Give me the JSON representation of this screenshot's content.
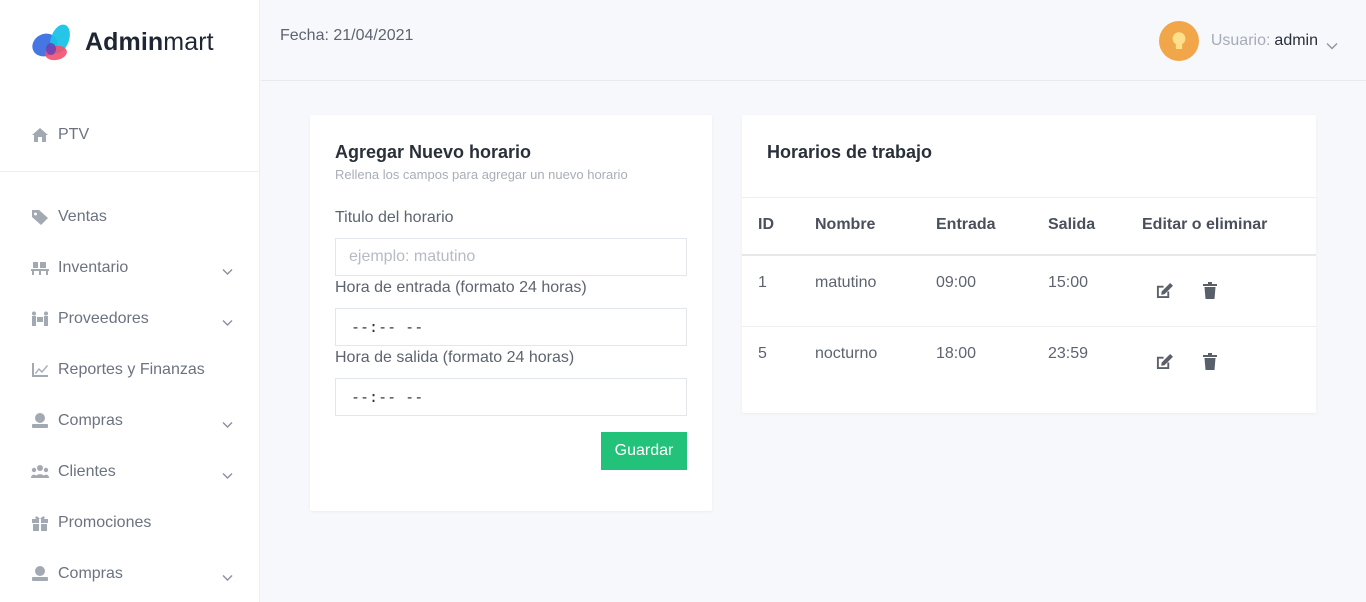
{
  "brand": {
    "bold": "Admin",
    "light": "mart"
  },
  "sidebar": {
    "items": [
      {
        "label": "PTV",
        "icon": "home-icon",
        "expandable": false
      },
      {
        "label": "Ventas",
        "icon": "tag-icon",
        "expandable": false
      },
      {
        "label": "Inventario",
        "icon": "pallet-icon",
        "expandable": true
      },
      {
        "label": "Proveedores",
        "icon": "people-carry-icon",
        "expandable": true
      },
      {
        "label": "Reportes y Finanzas",
        "icon": "chart-line-icon",
        "expandable": false
      },
      {
        "label": "Compras",
        "icon": "money-user-icon",
        "expandable": true
      },
      {
        "label": "Clientes",
        "icon": "users-icon",
        "expandable": true
      },
      {
        "label": "Promociones",
        "icon": "gift-icon",
        "expandable": false
      },
      {
        "label": "Compras",
        "icon": "money-user-icon",
        "expandable": true
      }
    ]
  },
  "topbar": {
    "date": "Fecha: 21/04/2021",
    "user_label": "Usuario:",
    "user_name": "admin"
  },
  "form": {
    "title": "Agregar Nuevo horario",
    "subtitle": "Rellena los campos para agregar un nuevo horario",
    "name_label": "Titulo del horario",
    "name_placeholder": "ejemplo: matutino",
    "start_label": "Hora de entrada (formato 24 horas)",
    "start_value": "--:-- --",
    "end_label": "Hora de salida (formato 24 horas)",
    "end_value": "--:-- --",
    "save_label": "Guardar"
  },
  "table": {
    "title": "Horarios de trabajo",
    "headers": [
      "ID",
      "Nombre",
      "Entrada",
      "Salida",
      "Editar o eliminar"
    ],
    "rows": [
      {
        "id": "1",
        "nombre": "matutino",
        "entrada": "09:00",
        "salida": "15:00"
      },
      {
        "id": "5",
        "nombre": "nocturno",
        "entrada": "18:00",
        "salida": "23:59"
      }
    ]
  },
  "colors": {
    "accent_green": "#22c27a",
    "avatar_orange": "#f1a64a",
    "logo_blue": "#3b6fe0",
    "logo_cyan": "#19c3e6",
    "logo_pink": "#f2506b"
  }
}
